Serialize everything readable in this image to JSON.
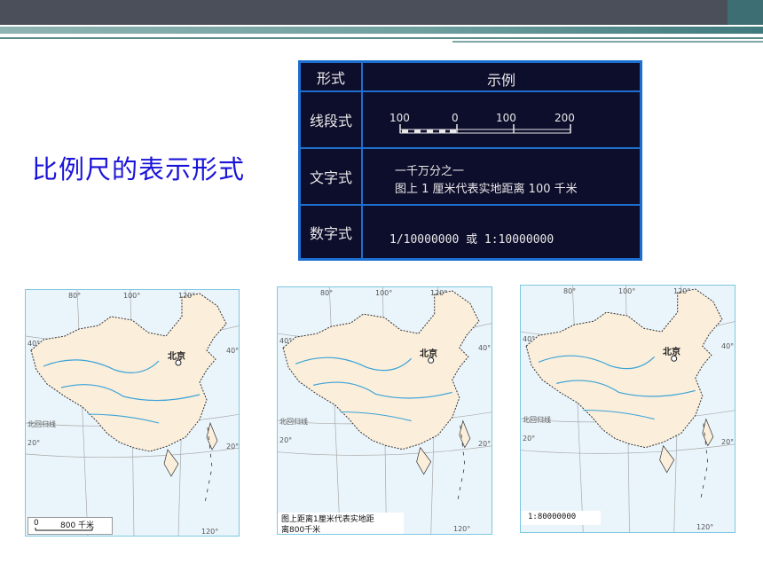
{
  "slide": {
    "title": "比例尺的表示形式"
  },
  "table": {
    "header": {
      "form": "形式",
      "example": "示例"
    },
    "rows": [
      {
        "label": "线段式",
        "ticks": [
          "100",
          "0",
          "100",
          "200"
        ]
      },
      {
        "label": "文字式",
        "line1": "一千万分之一",
        "line2": "图上 1 厘米代表实地距离 100 千米"
      },
      {
        "label": "数字式",
        "value": "1/10000000 或 1:10000000"
      }
    ]
  },
  "maps": [
    {
      "scale_text": "800 千米",
      "scale_zero": "0",
      "city": "北京",
      "lon_labels": [
        "80°",
        "100°",
        "120°",
        "120°"
      ],
      "lat_labels": [
        "40°",
        "40°",
        "20°",
        "20°"
      ],
      "tropic": "北回归线"
    },
    {
      "scale_text_line1": "图上距离1厘米代表实地距",
      "scale_text_line2": "离800千米",
      "city": "北京",
      "lon_labels": [
        "80°",
        "100°",
        "120°",
        "120°"
      ],
      "lat_labels": [
        "40°",
        "40°",
        "20°",
        "20°"
      ],
      "tropic": "北回归线"
    },
    {
      "scale_text": "1:80000000",
      "city": "北京",
      "lon_labels": [
        "80°",
        "100°",
        "120°",
        "120°"
      ],
      "lat_labels": [
        "40°",
        "40°",
        "20°",
        "20°"
      ],
      "tropic": "北回归线"
    }
  ],
  "colors": {
    "title": "#1a14d8",
    "table_bg": "#0d0d2c",
    "table_border": "#1f6fd0",
    "land": "#fbeedb",
    "sea": "#eaf5fb",
    "river": "#3aa3d8"
  }
}
